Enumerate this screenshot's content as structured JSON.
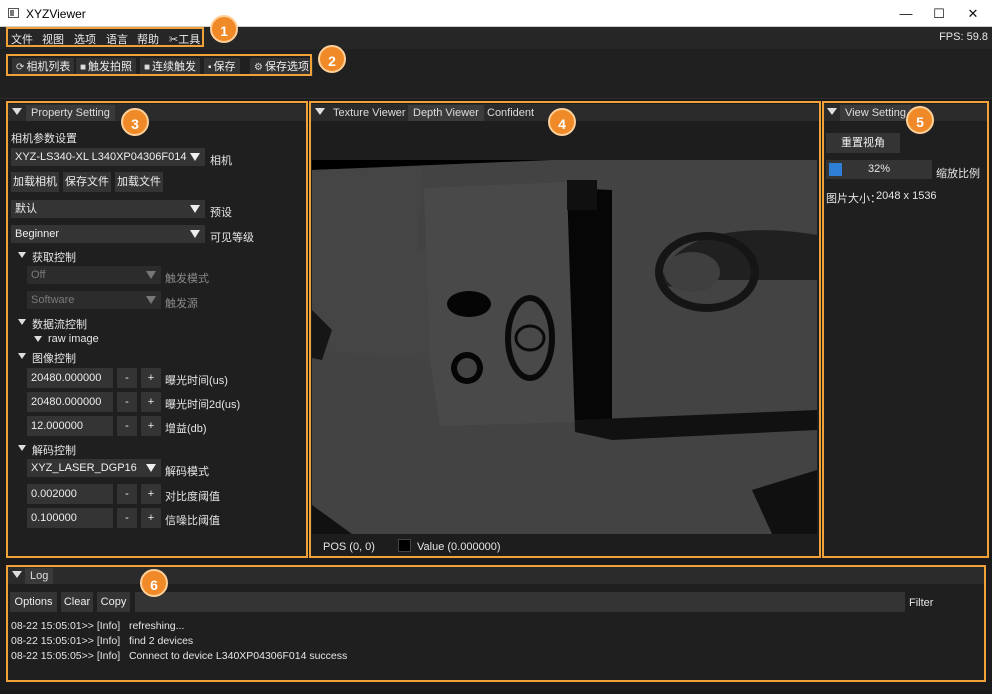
{
  "window": {
    "title": "XYZViewer",
    "controls": [
      "—",
      "☐",
      "✕"
    ]
  },
  "menu": {
    "items": [
      "文件",
      "视图",
      "选项",
      "语言",
      "帮助",
      "工具"
    ],
    "fps": "FPS: 59.8"
  },
  "toolbar": {
    "camera_list": "相机列表",
    "trigger_shot": "触发拍照",
    "continuous_trigger": "连续触发",
    "save": "保存",
    "save_options": "保存选项"
  },
  "property": {
    "title": "Property Setting",
    "camera_params_label": "相机参数设置",
    "camera_value": "XYZ-LS340-XL L340XP04306F014",
    "camera_label": "相机",
    "load_camera": "加载相机",
    "save_file": "保存文件",
    "load_file": "加载文件",
    "preset_value": "默认",
    "preset_label": "预设",
    "visibility_value": "Beginner",
    "visibility_label": "可见等级",
    "acquisition": {
      "title": "获取控制",
      "trigger_mode_value": "Off",
      "trigger_mode_label": "触发模式",
      "trigger_source_value": "Software",
      "trigger_source_label": "触发源"
    },
    "stream": {
      "title": "数据流控制",
      "raw": "raw image"
    },
    "image": {
      "title": "图像控制",
      "exposure_value": "20480.000000",
      "exposure_label": "曝光时间(us)",
      "exposure2d_value": "20480.000000",
      "exposure2d_label": "曝光时间2d(us)",
      "gain_value": "12.000000",
      "gain_label": "增益(db)"
    },
    "decode": {
      "title": "解码控制",
      "mode_value": "XYZ_LASER_DGP16",
      "mode_label": "解码模式",
      "contrast_value": "0.002000",
      "contrast_label": "对比度阈值",
      "snr_value": "0.100000",
      "snr_label": "信噪比阈值"
    },
    "minus": "-",
    "plus": "+"
  },
  "viewer": {
    "tabs": [
      "Texture Viewer",
      "Depth Viewer",
      "Confident"
    ],
    "active_tab": 1,
    "pos": "POS (0, 0)",
    "value": "Value (0.000000)"
  },
  "view_setting": {
    "title": "View Setting",
    "reset_view": "重置视角",
    "zoom_value": "32%",
    "zoom_fraction": 0.32,
    "zoom_label": "缩放比例",
    "image_size_label": "图片大小：",
    "image_size_value": "2048 x 1536"
  },
  "log": {
    "title": "Log",
    "options": "Options",
    "clear": "Clear",
    "copy": "Copy",
    "filter": "Filter",
    "lines": [
      {
        "time": "08-22 15:05:01>> [Info]",
        "msg": "refreshing..."
      },
      {
        "time": "08-22 15:05:01>> [Info]",
        "msg": "find 2 devices"
      },
      {
        "time": "08-22 15:05:05>> [Info]",
        "msg": "Connect to device L340XP04306F014 success"
      }
    ]
  },
  "annotations": [
    "1",
    "2",
    "3",
    "4",
    "5",
    "6"
  ],
  "colors": {
    "accent": "#f0a139",
    "badge": "#f08a28",
    "progress": "#2f7fd8"
  }
}
